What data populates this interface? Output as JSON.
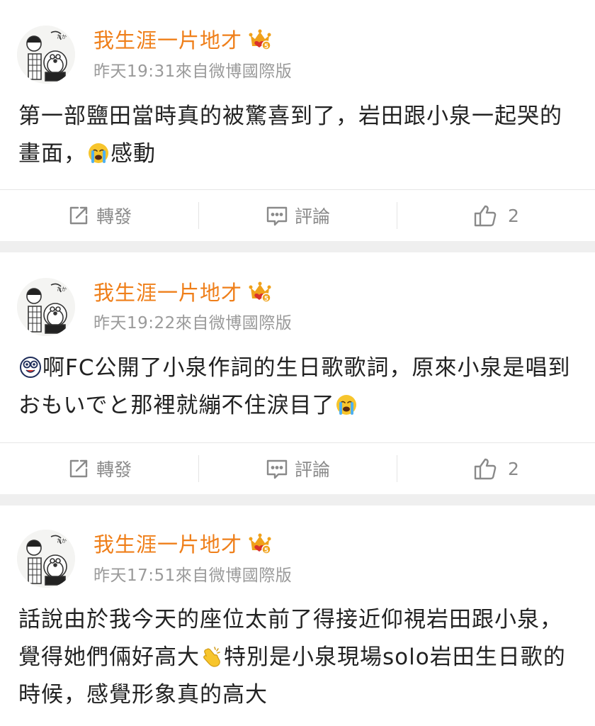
{
  "posts": [
    {
      "author": "我生涯一片地才",
      "meta": "昨天19:31來自微博國際版",
      "body_segments": [
        {
          "type": "text",
          "value": "第一部鹽田當時真的被驚喜到了，岩田跟小泉一起哭的畫面，"
        },
        {
          "type": "emoji",
          "value": "crying-emoji"
        },
        {
          "type": "text",
          "value": "感動"
        }
      ],
      "actions": {
        "repost": "轉發",
        "comment": "評論",
        "likes": "2"
      }
    },
    {
      "author": "我生涯一片地才",
      "meta": "昨天19:22來自微博國際版",
      "body_segments": [
        {
          "type": "emoji",
          "value": "silly-emoji"
        },
        {
          "type": "text",
          "value": "啊FC公開了小泉作詞的生日歌歌詞，原來小泉是唱到おもいでと那裡就繃不住淚目了"
        },
        {
          "type": "emoji",
          "value": "crying-emoji"
        }
      ],
      "actions": {
        "repost": "轉發",
        "comment": "評論",
        "likes": "2"
      }
    },
    {
      "author": "我生涯一片地才",
      "meta": "昨天17:51來自微博國際版",
      "body_segments": [
        {
          "type": "text",
          "value": "話說由於我今天的座位太前了得接近仰視岩田跟小泉，覺得她們倆好高大"
        },
        {
          "type": "emoji",
          "value": "clapping-hands-emoji"
        },
        {
          "type": "text",
          "value": "特別是小泉現場solo岩田生日歌的時候，感覺形象真的高大"
        }
      ]
    }
  ],
  "colors": {
    "author": "#ef7f1a",
    "meta": "#9a9a9a",
    "body": "#222222",
    "action": "#8a8a8a",
    "separator": "#efefef",
    "badge": "#f0a11a"
  },
  "icons": {
    "repost": "share-box-icon",
    "comment": "speech-bubble-icon",
    "like": "thumbs-up-icon",
    "badge": "vip-crown-badge-icon"
  }
}
